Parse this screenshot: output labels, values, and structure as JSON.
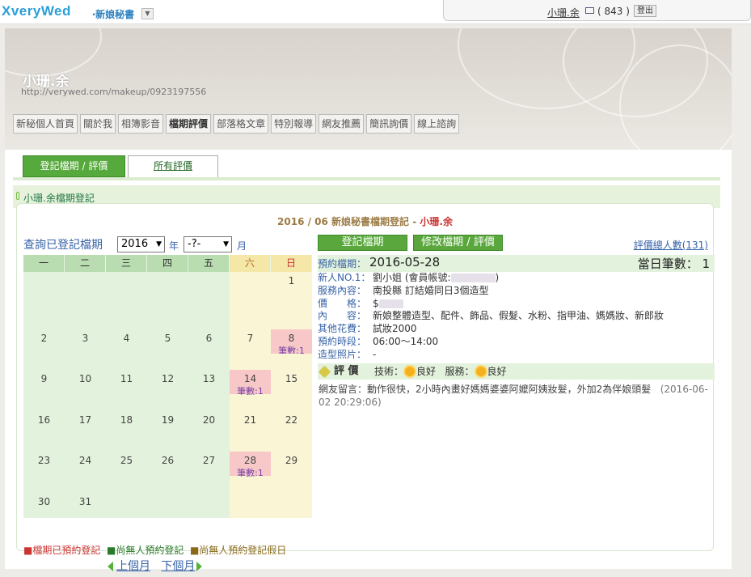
{
  "topbar": {
    "logo": "xveryWed",
    "logo_x": "X",
    "logo_rest": "veryWed",
    "sub_title": "‧新娘秘書",
    "user_name": "小珊.余",
    "mail_count": "( 843 )",
    "logout_label": "登出"
  },
  "banner": {
    "name": "小珊.余",
    "url": "http://verywed.com/makeup/0923197556"
  },
  "nav": [
    "新秘個人首頁",
    "關於我",
    "相簿影音",
    "檔期評價",
    "部落格文章",
    "特別報導",
    "網友推薦",
    "簡訊詢價",
    "線上諮詢"
  ],
  "tabs": {
    "register": "登記檔期 / 評價",
    "all": "所有評價"
  },
  "section_title": "小珊.余檔期登記",
  "panel": {
    "head_date": "2016 / 06",
    "head_text": " 新娘秘書檔期登記 - ",
    "head_who": "小珊.余"
  },
  "query": {
    "label": "查詢已登記檔期",
    "year": "2016",
    "year_unit": "年",
    "month": "-?-",
    "month_unit": "月"
  },
  "calendar": {
    "weekdays": [
      "一",
      "二",
      "三",
      "四",
      "五",
      "六",
      "日"
    ],
    "count_label": "筆數:1",
    "legend_booked": "■檔期已預約登記",
    "legend_free": "■尚無人預約登記",
    "legend_free_holiday": "■尚無人預約登記假日",
    "prev": "上個月",
    "next": "下個月"
  },
  "actions": {
    "register": "登記檔期",
    "edit": "修改檔期 / 評價",
    "rating_count": "評價總人數(131)"
  },
  "detail": {
    "date_key": "預約檔期：",
    "date": "2016-05-28",
    "daily_count": "當日筆數： 1",
    "rows": [
      {
        "k": "新人NO.1：",
        "v": "劉小姐 (會員帳號:",
        "v2": ")"
      },
      {
        "k": "服務內容：",
        "v": "南投縣 訂結婚同日3個造型"
      },
      {
        "k": "價　　格：",
        "v": "$"
      },
      {
        "k": "內　　容：",
        "v": "新娘整體造型、配件、飾品、假髮、水粉、指甲油、媽媽妝、新郎妝"
      },
      {
        "k": "其他花費：",
        "v": "試妝2000"
      },
      {
        "k": "預約時段：",
        "v": "06:00～14:00"
      },
      {
        "k": "造型照片：",
        "v": "-"
      }
    ],
    "eval_title": "評 價",
    "eval_tech": "技術：",
    "eval_tech_val": "良好",
    "eval_service": "服務：",
    "eval_service_val": "良好",
    "comment": "網友留言：動作很快，2小時內畫好媽媽婆婆阿嬤阿姨妝髮，外加2為伴娘頭髮",
    "comment_time": "(2016-06-02 20:29:06)"
  },
  "colors": {
    "accent_green": "#56a93c",
    "booked_pink": "#f7c8c7",
    "free_green": "#e3f2dc",
    "holiday_yellow": "#faf5d5"
  }
}
